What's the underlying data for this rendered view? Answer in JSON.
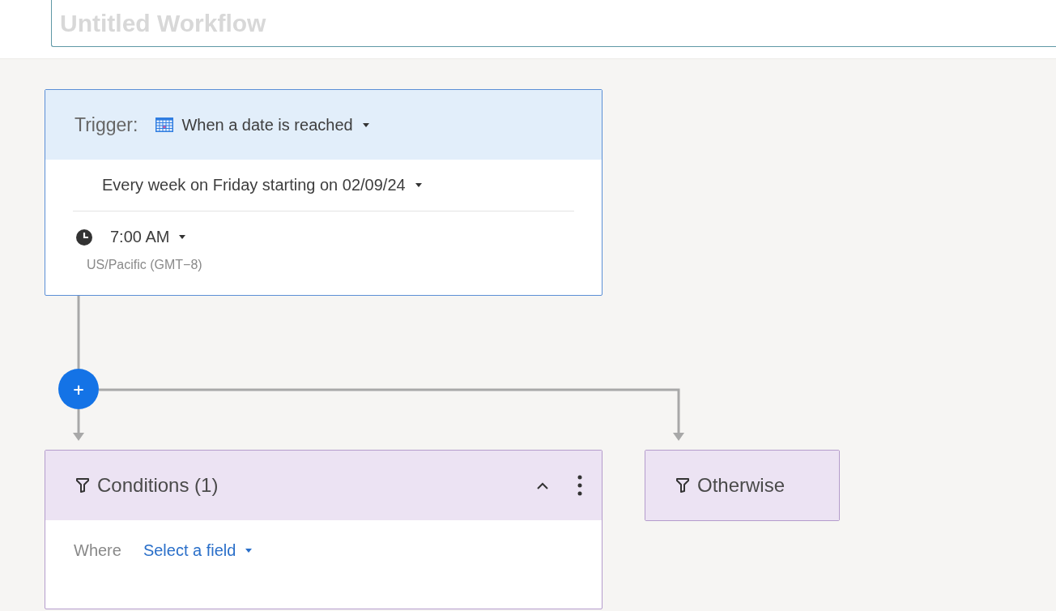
{
  "title_field": {
    "placeholder": "Untitled Workflow"
  },
  "trigger": {
    "label": "Trigger:",
    "type": "When a date is reached",
    "schedule": "Every week on Friday starting on 02/09/24",
    "time": "7:00 AM",
    "timezone": "US/Pacific (GMT−8)"
  },
  "add_button": {
    "label": "+"
  },
  "conditions": {
    "title": "Conditions (1)",
    "expanded": true,
    "where_label": "Where",
    "field": "Select a field"
  },
  "otherwise": {
    "title": "Otherwise"
  }
}
